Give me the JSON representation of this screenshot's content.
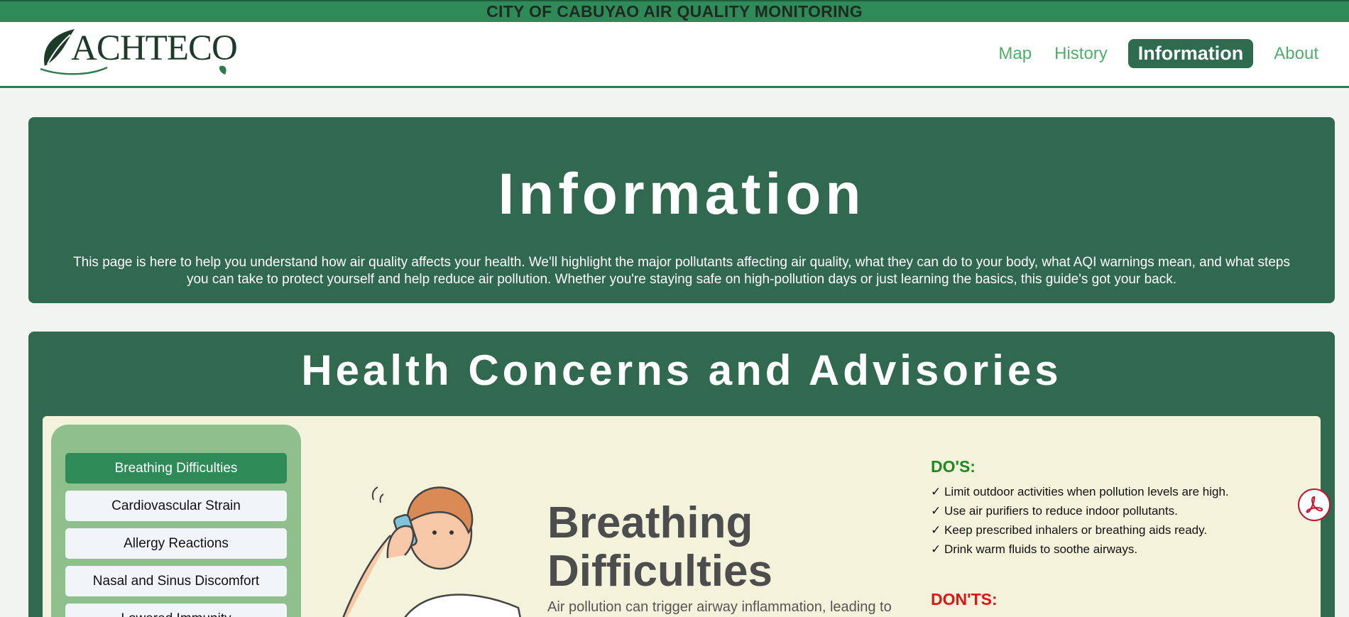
{
  "banner": {
    "title": "CITY OF CABUYAO AIR QUALITY MONITORING"
  },
  "brand": {
    "name": "ACHTECO"
  },
  "nav": {
    "items": [
      {
        "label": "Map"
      },
      {
        "label": "History"
      },
      {
        "label": "Information"
      },
      {
        "label": "About"
      }
    ],
    "active": "Information"
  },
  "hero": {
    "title": "Information",
    "description": "This page is here to help you understand how air quality affects your health. We'll highlight the major pollutants affecting air quality, what they can do to your body, what AQI warnings mean, and what steps you can take to protect yourself and help reduce air pollution. Whether you're staying safe on high-pollution days or just learning the basics, this guide's got your back."
  },
  "health": {
    "title": "Health Concerns and Advisories",
    "topics": [
      {
        "label": "Breathing Difficulties"
      },
      {
        "label": "Cardiovascular Strain"
      },
      {
        "label": "Allergy Reactions"
      },
      {
        "label": "Nasal and Sinus Discomfort"
      },
      {
        "label": "Lowered Immunity"
      }
    ],
    "active_topic": "Breathing Difficulties",
    "detail": {
      "title": "Breathing Difficulties",
      "description": "Air pollution can trigger airway inflammation, leading to"
    },
    "dos": {
      "heading": "DO'S:",
      "items": [
        "✓ Limit outdoor activities when pollution levels are high.",
        "✓ Use air purifiers to reduce indoor pollutants.",
        "✓ Keep prescribed inhalers or breathing aids ready.",
        "✓ Drink warm fluids to soothe airways."
      ]
    },
    "donts": {
      "heading": "DON'TS:"
    }
  },
  "colors": {
    "brand_green": "#2e8b57",
    "dark_green": "#30694f",
    "panel_bg": "#f3f3dc",
    "sidebar_bg": "#8fbf8d",
    "dos_color": "#1e8a1e",
    "donts_color": "#e01414"
  },
  "icons": {
    "floating_button": "pdf-icon",
    "logo": "leaf-icon"
  }
}
